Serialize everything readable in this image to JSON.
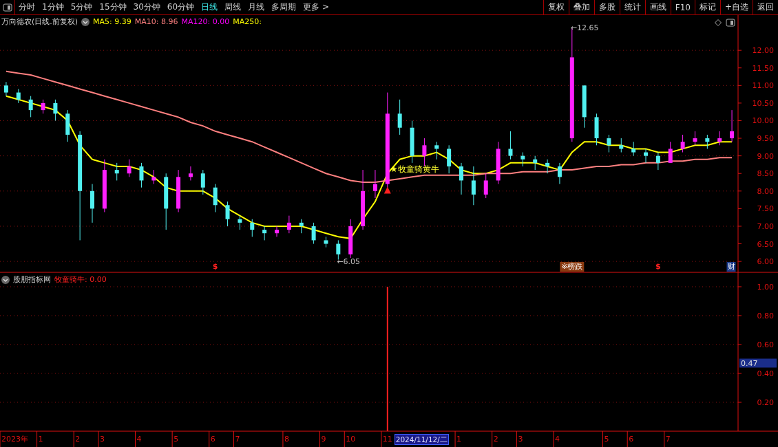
{
  "toolbar": {
    "tabs": [
      {
        "label": "分时",
        "selected": false
      },
      {
        "label": "1分钟",
        "selected": false
      },
      {
        "label": "5分钟",
        "selected": false
      },
      {
        "label": "15分钟",
        "selected": false
      },
      {
        "label": "30分钟",
        "selected": false
      },
      {
        "label": "60分钟",
        "selected": false
      },
      {
        "label": "日线",
        "selected": true
      },
      {
        "label": "周线",
        "selected": false
      },
      {
        "label": "月线",
        "selected": false
      },
      {
        "label": "多周期",
        "selected": false
      },
      {
        "label": "更多 >",
        "selected": false
      }
    ],
    "buttons": [
      "复权",
      "叠加",
      "多股",
      "统计",
      "画线",
      "F10",
      "标记",
      "+自选",
      "返回"
    ]
  },
  "main": {
    "legend": {
      "title": "万向德农(日线.前复权)",
      "items": [
        {
          "label": "MA5: 9.39",
          "color": "#ffff00"
        },
        {
          "label": "MA10: 8.96",
          "color": "#ff8080"
        },
        {
          "label": "MA120: 0.00",
          "color": "#ff00ff"
        },
        {
          "label": "MA250:",
          "color": "#ffff00"
        }
      ]
    },
    "chart_data": {
      "type": "candlestick",
      "ylim": [
        5.67,
        13.0
      ],
      "grid": true,
      "categories": [
        null,
        null,
        null,
        null,
        null,
        null,
        null,
        null,
        null,
        null,
        null,
        null,
        null,
        null,
        null,
        null,
        null,
        "$",
        null,
        null,
        null,
        null,
        null,
        null,
        null,
        null,
        null,
        null,
        null,
        null,
        null,
        null,
        null,
        null,
        null,
        null,
        null,
        null,
        null,
        null,
        null,
        null,
        null,
        null,
        null,
        null,
        "※榜跌",
        null,
        null,
        null,
        null,
        null,
        null,
        "$",
        null,
        null,
        null,
        null,
        null,
        "财"
      ],
      "yticks": [
        {
          "value": 6,
          "label": "6.00"
        },
        {
          "value": 6.5,
          "label": "6.50"
        },
        {
          "value": 7,
          "label": "7.00"
        },
        {
          "value": 7.5,
          "label": "7.50"
        },
        {
          "value": 8,
          "label": "8.00"
        },
        {
          "value": 8.5,
          "label": "8.50"
        },
        {
          "value": 9,
          "label": "9.00"
        },
        {
          "value": 9.5,
          "label": "9.50"
        },
        {
          "value": 10,
          "label": "10.00"
        },
        {
          "value": 10.5,
          "label": "10.50"
        },
        {
          "value": 11,
          "label": "11.00"
        },
        {
          "value": 11.5,
          "label": "11.50"
        },
        {
          "value": 12,
          "label": "12.00"
        }
      ],
      "ohlc": [
        [
          11.0,
          11.1,
          10.7,
          10.8
        ],
        [
          10.8,
          10.9,
          10.5,
          10.6
        ],
        [
          10.6,
          10.7,
          10.1,
          10.3
        ],
        [
          10.3,
          10.6,
          10.2,
          10.5
        ],
        [
          10.5,
          10.6,
          10.0,
          10.2
        ],
        [
          10.2,
          10.3,
          9.4,
          9.6
        ],
        [
          9.6,
          9.7,
          6.6,
          8.0
        ],
        [
          8.0,
          8.2,
          7.1,
          7.5
        ],
        [
          7.5,
          8.9,
          7.4,
          8.6
        ],
        [
          8.6,
          8.8,
          8.3,
          8.5
        ],
        [
          8.5,
          8.9,
          8.4,
          8.7
        ],
        [
          8.7,
          8.8,
          8.1,
          8.3
        ],
        [
          8.3,
          8.6,
          8.2,
          8.4
        ],
        [
          8.4,
          8.5,
          6.9,
          7.5
        ],
        [
          7.5,
          8.6,
          7.4,
          8.4
        ],
        [
          8.4,
          8.7,
          8.3,
          8.5
        ],
        [
          8.5,
          8.6,
          7.9,
          8.1
        ],
        [
          8.1,
          8.2,
          7.4,
          7.6
        ],
        [
          7.6,
          7.7,
          7.0,
          7.2
        ],
        [
          7.2,
          7.3,
          6.9,
          7.1
        ],
        [
          7.1,
          7.2,
          6.7,
          6.9
        ],
        [
          6.9,
          7.0,
          6.6,
          6.8
        ],
        [
          6.8,
          7.0,
          6.7,
          6.9
        ],
        [
          6.9,
          7.3,
          6.8,
          7.1
        ],
        [
          7.1,
          7.2,
          6.8,
          7.0
        ],
        [
          7.0,
          7.1,
          6.5,
          6.6
        ],
        [
          6.6,
          6.7,
          6.4,
          6.5
        ],
        [
          6.5,
          6.6,
          6.05,
          6.2
        ],
        [
          6.2,
          7.2,
          6.1,
          7.0
        ],
        [
          7.0,
          8.6,
          6.9,
          8.0
        ],
        [
          8.0,
          8.6,
          7.8,
          8.2
        ],
        [
          8.2,
          10.8,
          8.1,
          10.2
        ],
        [
          10.2,
          10.6,
          9.6,
          9.8
        ],
        [
          9.8,
          10.0,
          8.8,
          9.0
        ],
        [
          9.0,
          9.5,
          8.7,
          9.3
        ],
        [
          9.3,
          9.4,
          8.9,
          9.2
        ],
        [
          9.2,
          9.3,
          8.5,
          8.7
        ],
        [
          8.7,
          8.8,
          7.9,
          8.3
        ],
        [
          8.3,
          8.7,
          7.6,
          7.9
        ],
        [
          7.9,
          8.5,
          7.8,
          8.3
        ],
        [
          8.3,
          9.4,
          8.2,
          9.2
        ],
        [
          9.2,
          9.7,
          8.9,
          9.0
        ],
        [
          9.0,
          9.1,
          8.7,
          8.9
        ],
        [
          8.9,
          9.0,
          8.6,
          8.8
        ],
        [
          8.8,
          8.9,
          8.5,
          8.7
        ],
        [
          8.7,
          8.8,
          8.2,
          8.4
        ],
        [
          9.5,
          12.65,
          9.4,
          11.8
        ],
        [
          11.0,
          11.0,
          9.8,
          10.1
        ],
        [
          10.1,
          10.2,
          9.3,
          9.5
        ],
        [
          9.5,
          9.6,
          9.1,
          9.3
        ],
        [
          9.3,
          9.5,
          9.1,
          9.2
        ],
        [
          9.2,
          9.4,
          9.0,
          9.1
        ],
        [
          9.1,
          9.2,
          8.8,
          9.0
        ],
        [
          9.0,
          9.1,
          8.6,
          8.8
        ],
        [
          8.8,
          9.4,
          8.8,
          9.2
        ],
        [
          9.2,
          9.6,
          9.1,
          9.4
        ],
        [
          9.4,
          9.7,
          9.3,
          9.5
        ],
        [
          9.5,
          9.6,
          9.2,
          9.4
        ],
        [
          9.4,
          9.7,
          9.3,
          9.5
        ],
        [
          9.5,
          10.3,
          9.4,
          9.7
        ]
      ],
      "series": [
        {
          "type": "line",
          "color": "#ffff00",
          "values": [
            10.7,
            10.6,
            10.5,
            10.4,
            10.3,
            10.0,
            9.3,
            8.9,
            8.8,
            8.7,
            8.7,
            8.6,
            8.4,
            8.1,
            8.0,
            8.0,
            8.0,
            7.8,
            7.5,
            7.3,
            7.1,
            7.0,
            7.0,
            7.0,
            7.0,
            6.9,
            6.8,
            6.7,
            6.65,
            7.2,
            7.7,
            8.5,
            8.9,
            9.0,
            9.0,
            9.1,
            8.9,
            8.6,
            8.5,
            8.5,
            8.6,
            8.8,
            8.8,
            8.8,
            8.7,
            8.6,
            9.1,
            9.4,
            9.4,
            9.3,
            9.3,
            9.2,
            9.2,
            9.1,
            9.1,
            9.2,
            9.3,
            9.3,
            9.4,
            9.4
          ]
        },
        {
          "type": "line",
          "color": "#ff8080",
          "values": [
            11.4,
            11.35,
            11.3,
            11.2,
            11.1,
            11.0,
            10.9,
            10.8,
            10.7,
            10.6,
            10.5,
            10.4,
            10.3,
            10.2,
            10.1,
            9.95,
            9.85,
            9.7,
            9.6,
            9.5,
            9.4,
            9.25,
            9.1,
            8.95,
            8.8,
            8.65,
            8.5,
            8.4,
            8.3,
            8.25,
            8.25,
            8.3,
            8.35,
            8.4,
            8.45,
            8.45,
            8.45,
            8.45,
            8.45,
            8.5,
            8.5,
            8.5,
            8.55,
            8.55,
            8.55,
            8.6,
            8.6,
            8.65,
            8.7,
            8.7,
            8.75,
            8.75,
            8.8,
            8.8,
            8.85,
            8.85,
            8.9,
            8.9,
            8.95,
            8.95
          ]
        }
      ]
    },
    "high_label": "←12.65",
    "low_label": "←6.05",
    "signal_label": "★牧童骑黄牛",
    "event_marks": [
      {
        "kind": "text",
        "color": "#ff2020"
      },
      {
        "kind": "badge",
        "color": "#8a3a10"
      },
      {
        "kind": "text",
        "color": "#ff2020"
      },
      {
        "kind": "badge",
        "color": "#1a3a8a"
      }
    ]
  },
  "indicator": {
    "legend": {
      "title": "股朋指标网",
      "items": [
        {
          "label": "牧童骑牛: 0.00",
          "color": "#ff2020"
        }
      ]
    },
    "chart_data": {
      "type": "bar",
      "ylim": [
        0,
        1.095
      ],
      "grid": true,
      "yticks": [
        {
          "value": 0.2,
          "label": "0.20"
        },
        {
          "value": 0.4,
          "label": "0.40"
        },
        {
          "value": 0.6,
          "label": "0.60"
        },
        {
          "value": 0.8,
          "label": "0.80"
        },
        {
          "value": 1.0,
          "label": "1.00"
        }
      ],
      "categories": [
        "2023年",
        null,
        null,
        "1",
        null,
        null,
        "2",
        null,
        "3",
        null,
        null,
        "4",
        null,
        null,
        "5",
        null,
        null,
        "6",
        null,
        "7",
        null,
        null,
        null,
        "8",
        null,
        null,
        "9",
        null,
        "10",
        null,
        null,
        "11",
        null,
        null,
        null,
        null,
        null,
        "1",
        null,
        null,
        "2",
        null,
        "3",
        null,
        null,
        "4",
        null,
        null,
        null,
        "5",
        null,
        "6",
        null,
        null,
        "7",
        null,
        null,
        null,
        null,
        null
      ],
      "values": [
        0,
        0,
        0,
        0,
        0,
        0,
        0,
        0,
        0,
        0,
        0,
        0,
        0,
        0,
        0,
        0,
        0,
        0,
        0,
        0,
        0,
        0,
        0,
        0,
        0,
        0,
        0,
        0,
        0,
        0,
        0,
        1,
        0,
        0,
        0,
        0,
        0,
        0,
        0,
        0,
        0,
        0,
        0,
        0,
        0,
        0,
        0,
        0,
        0,
        0,
        0,
        0,
        0,
        0,
        0,
        0,
        0,
        0,
        0,
        0
      ]
    },
    "cursor_value": "0.47",
    "cursor_date": "2024/11/12/二"
  }
}
